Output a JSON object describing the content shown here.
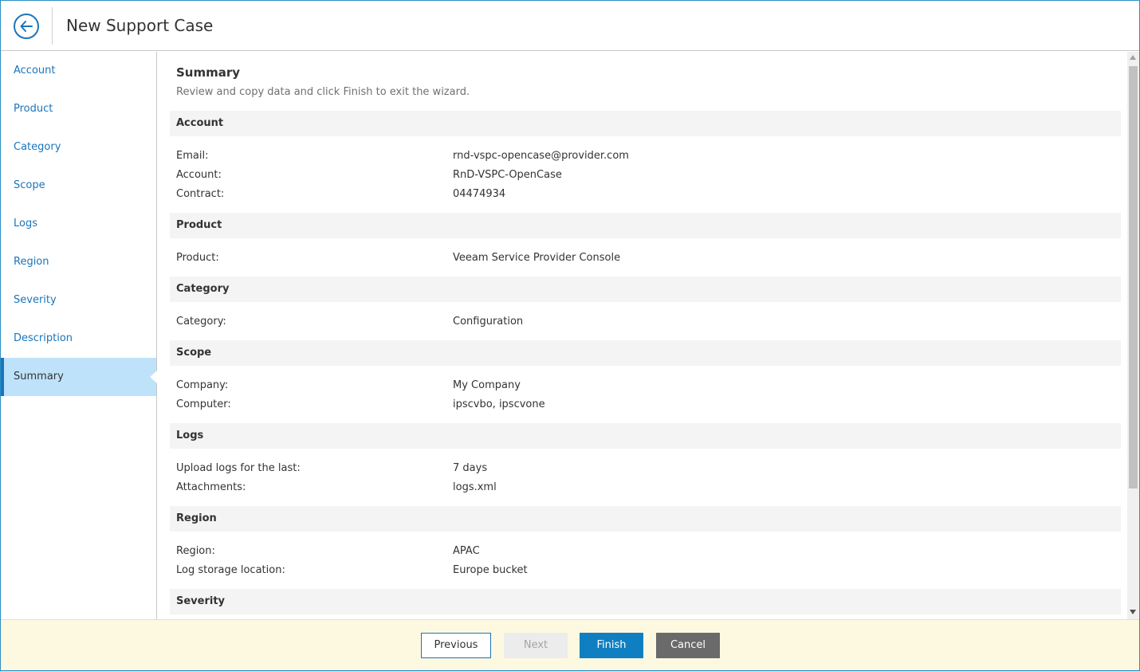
{
  "header": {
    "title": "New Support Case",
    "back_icon": "arrow-left-circle-icon"
  },
  "sidebar": {
    "items": [
      {
        "label": "Account"
      },
      {
        "label": "Product"
      },
      {
        "label": "Category"
      },
      {
        "label": "Scope"
      },
      {
        "label": "Logs"
      },
      {
        "label": "Region"
      },
      {
        "label": "Severity"
      },
      {
        "label": "Description"
      },
      {
        "label": "Summary",
        "active": true
      }
    ]
  },
  "summary": {
    "title": "Summary",
    "subtitle": "Review and copy data and click Finish to exit the wizard.",
    "sections": {
      "account": {
        "header": "Account",
        "rows": [
          {
            "label": "Email:",
            "value": "rnd-vspc-opencase@provider.com"
          },
          {
            "label": "Account:",
            "value": "RnD-VSPC-OpenCase"
          },
          {
            "label": "Contract:",
            "value": "04474934"
          }
        ]
      },
      "product": {
        "header": "Product",
        "rows": [
          {
            "label": "Product:",
            "value": "Veeam Service Provider Console"
          }
        ]
      },
      "category": {
        "header": "Category",
        "rows": [
          {
            "label": "Category:",
            "value": "Configuration"
          }
        ]
      },
      "scope": {
        "header": "Scope",
        "rows": [
          {
            "label": "Company:",
            "value": "My Company"
          },
          {
            "label": "Computer:",
            "value": "ipscvbo, ipscvone"
          }
        ]
      },
      "logs": {
        "header": "Logs",
        "rows": [
          {
            "label": "Upload logs for the last:",
            "value": "7 days"
          },
          {
            "label": "Attachments:",
            "value": "logs.xml"
          }
        ]
      },
      "region": {
        "header": "Region",
        "rows": [
          {
            "label": "Region:",
            "value": "APAC"
          },
          {
            "label": "Log storage location:",
            "value": "Europe bucket"
          }
        ]
      },
      "severity": {
        "header": "Severity"
      }
    }
  },
  "footer": {
    "previous_label": "Previous",
    "next_label": "Next",
    "finish_label": "Finish",
    "cancel_label": "Cancel"
  },
  "colors": {
    "accent": "#1a75bb",
    "active_nav_bg": "#bfe2fb",
    "footer_bg": "#fdf9e1",
    "finish_bg": "#0f7fc2",
    "cancel_bg": "#6a6a6a"
  }
}
